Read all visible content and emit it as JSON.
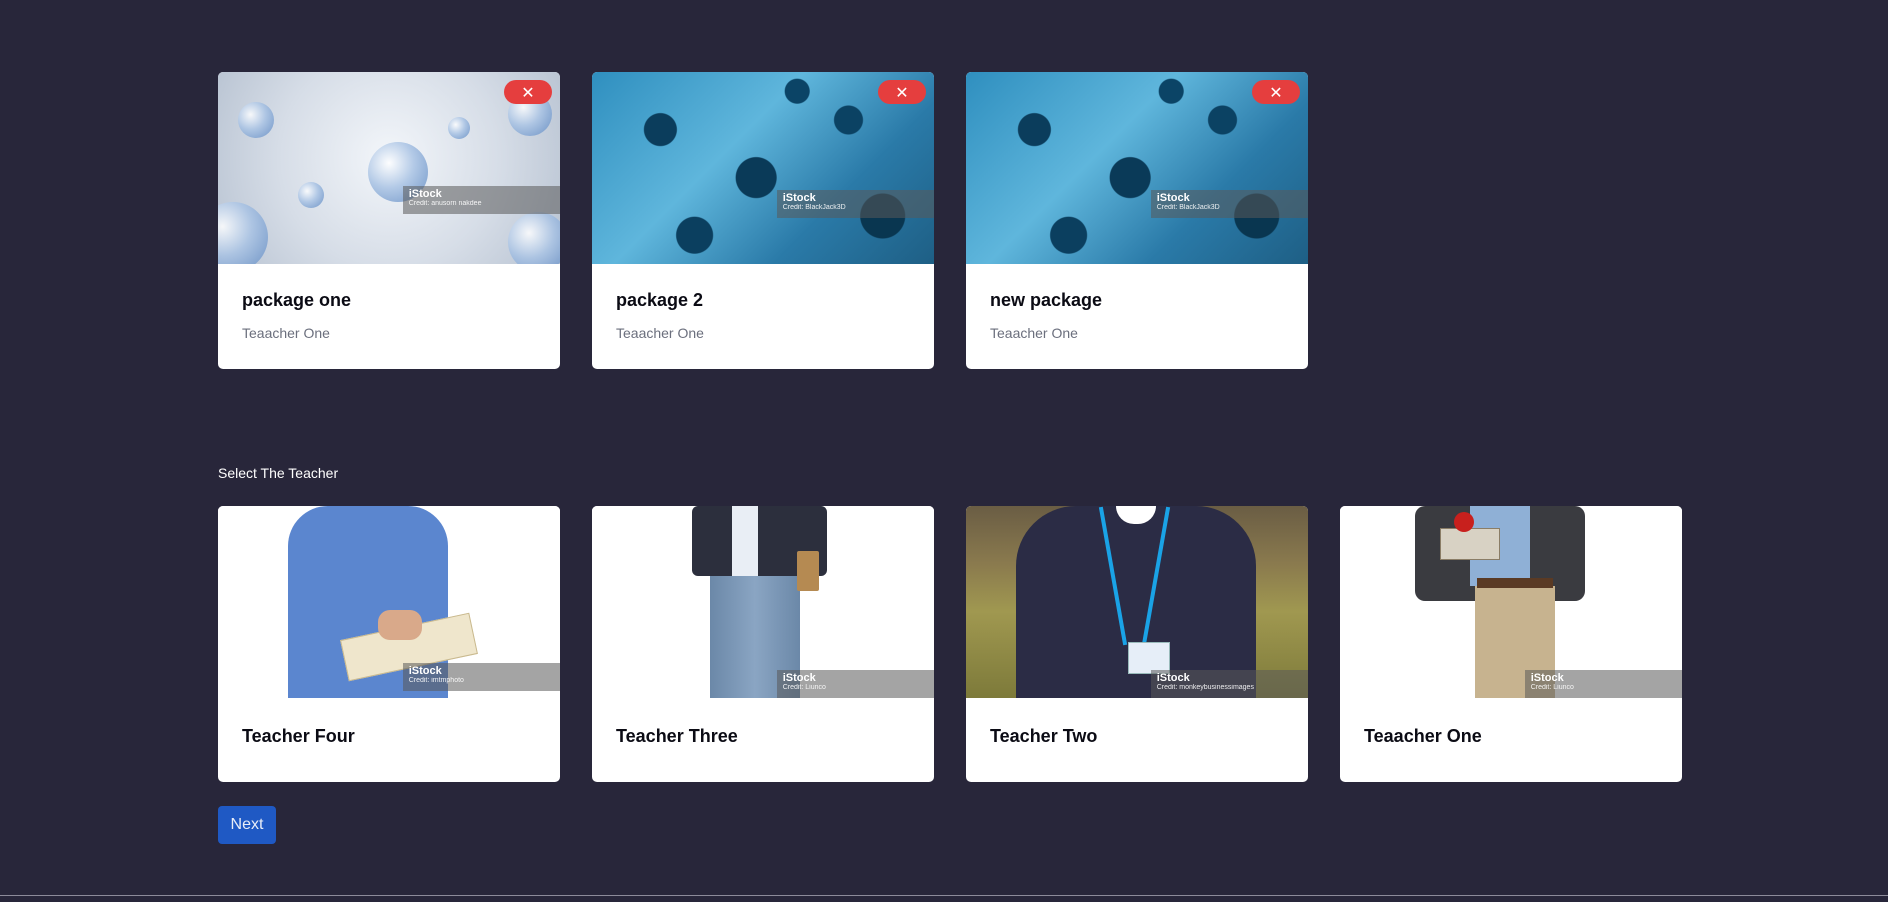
{
  "packages": [
    {
      "title": "package one",
      "teacher": "Teaacher One",
      "remove_label": "✕",
      "watermark": "iStock",
      "credit": "Credit: anusorn nakdee"
    },
    {
      "title": "package 2",
      "teacher": "Teaacher One",
      "remove_label": "✕",
      "watermark": "iStock",
      "credit": "Credit: BlackJack3D"
    },
    {
      "title": "new package",
      "teacher": "Teaacher One",
      "remove_label": "✕",
      "watermark": "iStock",
      "credit": "Credit: BlackJack3D"
    }
  ],
  "select_teacher_label": "Select The Teacher",
  "teachers": [
    {
      "name": "Teacher Four",
      "watermark": "iStock",
      "credit": "Credit: imtmphoto"
    },
    {
      "name": "Teacher Three",
      "watermark": "iStock",
      "credit": "Credit: Liunco"
    },
    {
      "name": "Teacher Two",
      "watermark": "iStock",
      "credit": "Credit: monkeybusinessimages"
    },
    {
      "name": "Teaacher One",
      "watermark": "iStock",
      "credit": "Credit: Liunco"
    }
  ],
  "next_label": "Next",
  "colors": {
    "background": "#28263a",
    "remove": "#e53e3e",
    "next": "#1f59c4"
  }
}
